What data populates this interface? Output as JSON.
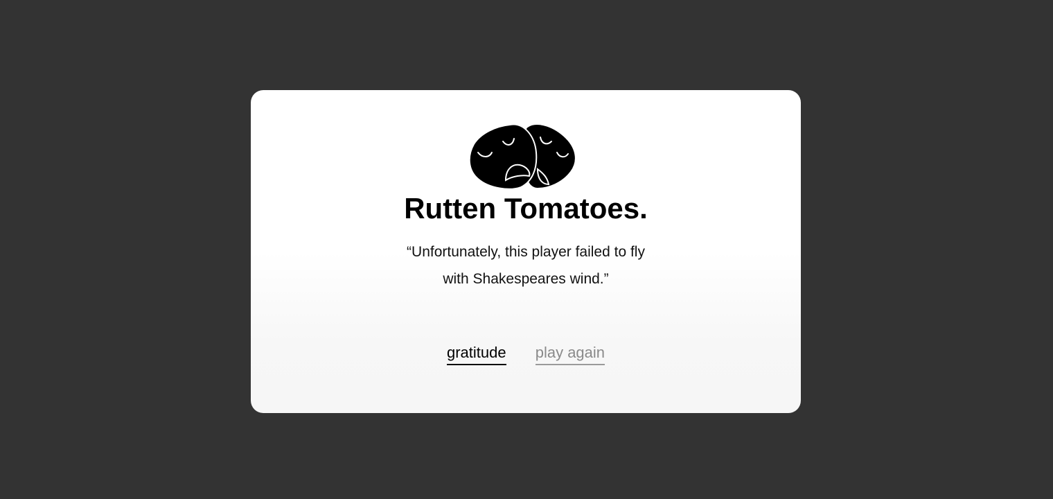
{
  "dialog": {
    "logo_icon": "theater-masks-icon",
    "title": "Rutten Tomatoes.",
    "quote_line1": "“Unfortunately, this player failed to fly",
    "quote_line2": "with Shakespeares wind.”",
    "actions": {
      "gratitude_label": "gratitude",
      "play_again_label": "play again"
    }
  },
  "colors": {
    "backdrop": "#333333",
    "card": "#ffffff",
    "primary_link": "#000000",
    "secondary_link": "#8a8a8a"
  }
}
